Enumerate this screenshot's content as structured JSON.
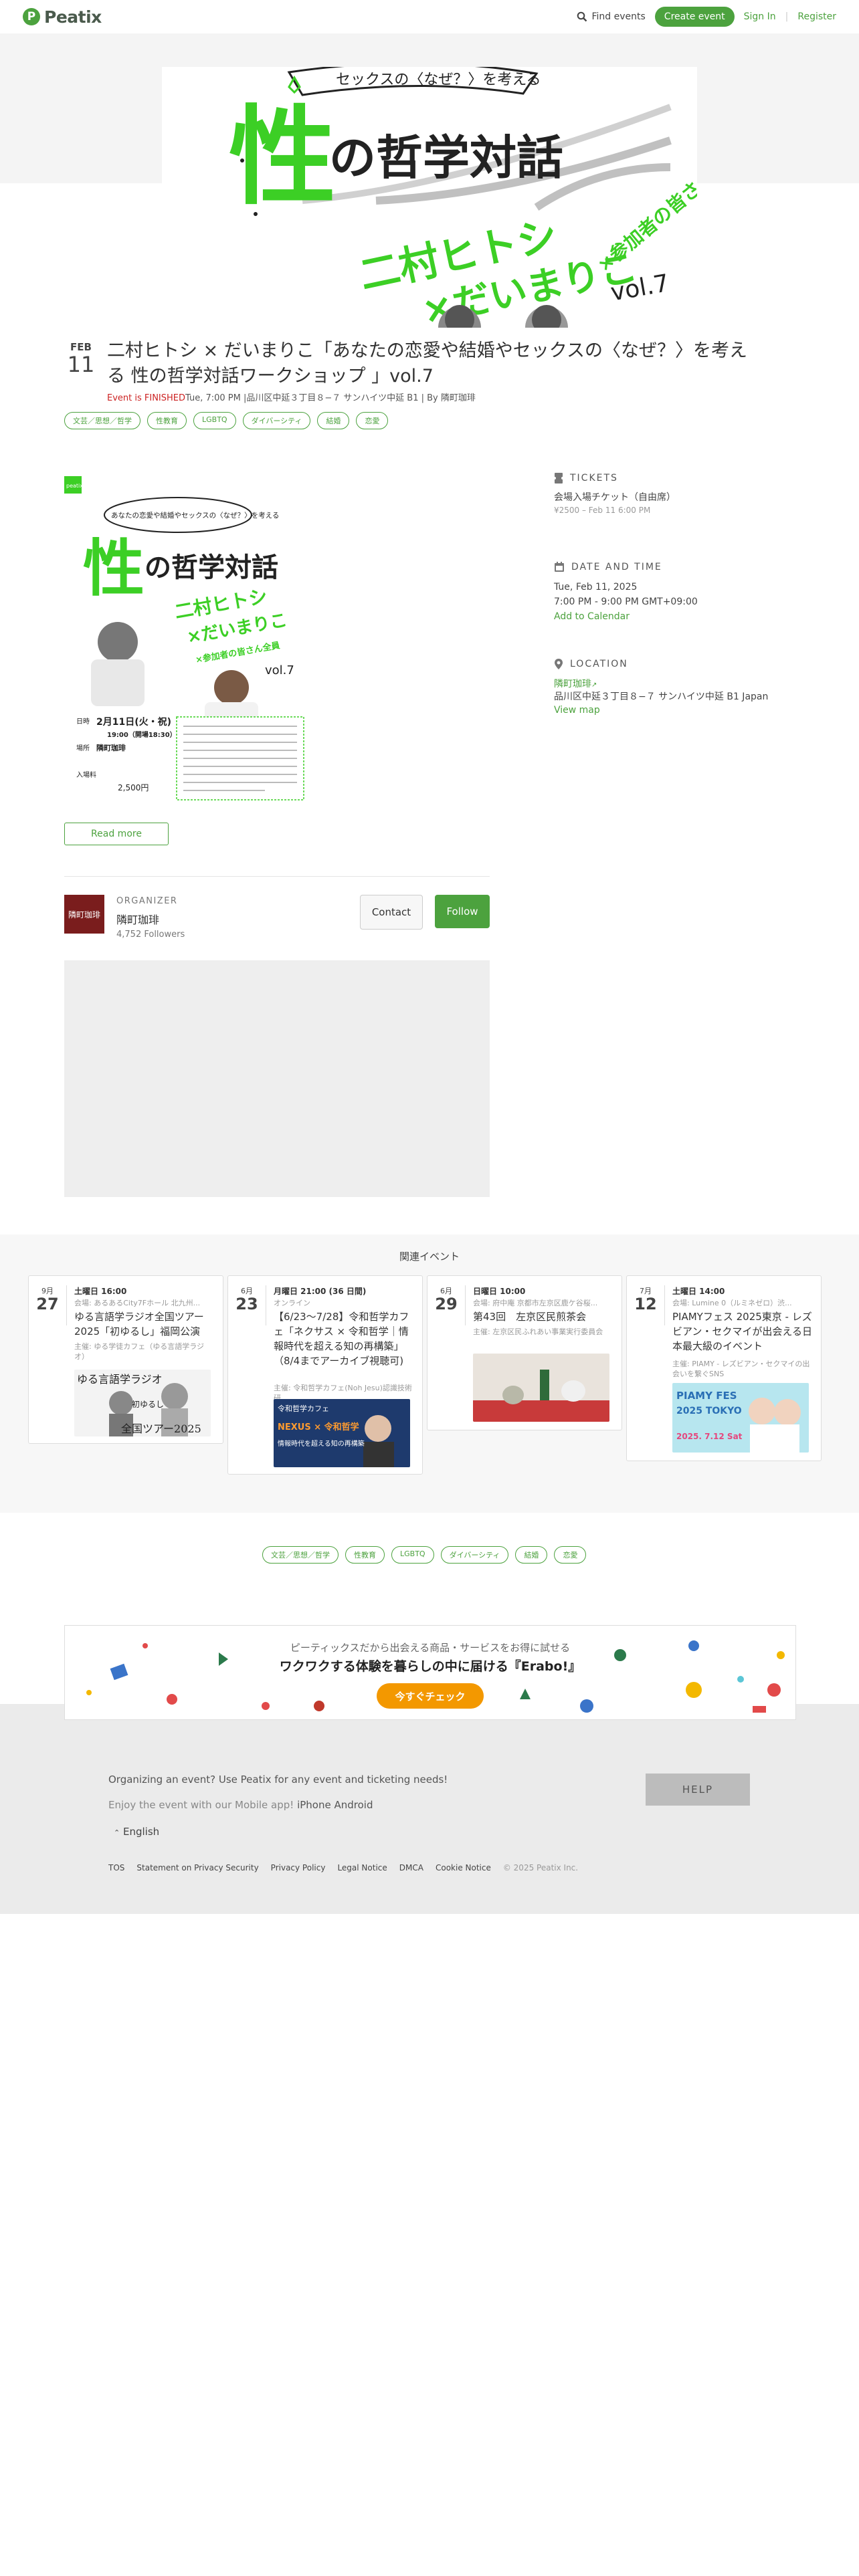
{
  "header": {
    "logo": "Peatix",
    "find": "Find events",
    "create": "Create event",
    "signin": "Sign In",
    "register": "Register"
  },
  "hero": {
    "top_text": "セックスの〈なぜ？〉を考える",
    "big1": "性",
    "big2": "の哲学対話",
    "names1": "二村ヒトシ",
    "names2": "×だいまりこ",
    "names3": "×参加者の皆さん全員",
    "vol": "vol.7"
  },
  "event": {
    "month": "FEB",
    "day": "11",
    "title": "二村ヒトシ × だいまりこ「あなたの恋愛や結婚やセックスの〈なぜ？〉を考える 性の哲学対話ワークショップ 」vol.7",
    "finished": "Event is FINISHED",
    "meta_rest": "Tue, 7:00 PM |品川区中延３丁目８−７ サンハイツ中延 B1 | By 隣町珈琲",
    "tags": [
      "文芸／思想／哲学",
      "性教育",
      "LGBTQ",
      "ダイバーシティ",
      "結婚",
      "恋愛"
    ]
  },
  "poster": {
    "badge": "peatix",
    "bubble": "あなたの恋愛や結婚やセックスの〈なぜ？〉を考える",
    "big1": "性",
    "big2": "の哲学対話",
    "names1": "二村ヒトシ",
    "names2": "×だいまりこ",
    "names3": "×参加者の皆さん全員",
    "vol": "vol.7",
    "date_label": "日時",
    "date_value": "2月11日(火・祝)",
    "time_value": "19:00（開場18:30）",
    "place_label": "場所",
    "place_value": "隣町珈琲",
    "fee_label": "入場料",
    "fee_value": "2,500円"
  },
  "read_more": "Read more",
  "organizer": {
    "label": "ORGANIZER",
    "logo_text": "隣町珈琲",
    "name": "隣町珈琲",
    "followers": "4,752 Followers",
    "contact": "Contact",
    "follow": "Follow"
  },
  "tickets": {
    "heading": "TICKETS",
    "name": "会場入場チケット（自由席）",
    "detail": "¥2500 – Feb 11 6:00 PM"
  },
  "datetime": {
    "heading": "DATE AND TIME",
    "date": "Tue, Feb 11, 2025",
    "time": "7:00 PM - 9:00 PM GMT+09:00",
    "calendar": "Add to Calendar"
  },
  "location": {
    "heading": "LOCATION",
    "venue": "隣町珈琲",
    "address": "品川区中延３丁目８−７ サンハイツ中延 B1 Japan",
    "map": "View map"
  },
  "related": {
    "title": "関連イベント",
    "cards": [
      {
        "month": "9月",
        "day": "27",
        "time": "土曜日 16:00",
        "venue": "会場: あるあるCity7Fホール 北九州...",
        "name": "ゆる言語学ラジオ全国ツアー2025「初ゆるし」福岡公演",
        "org": "主催: ゆる学徒カフェ（ゆる言語学ラジオ）",
        "img_text1": "ゆる言語学ラジオ",
        "img_text2": "初ゆるし",
        "img_text3": "全国ツアー2025"
      },
      {
        "month": "6月",
        "day": "23",
        "time": "月曜日 21:00 (36 日間)",
        "venue": "オンライン",
        "name": "【6/23〜7/28】令和哲学カフェ「ネクサス × 令和哲学｜情報時代を超える知の再構築」（8/4までアーカイブ視聴可)",
        "org": "主催: 令和哲学カフェ(Noh Jesu)認識技術研",
        "img_text1": "令和哲学カフェ",
        "img_text2": "NEXUS × 令和哲学",
        "img_text3": "情報時代を超える知の再構築"
      },
      {
        "month": "6月",
        "day": "29",
        "time": "日曜日 10:00",
        "venue": "会場: 府中庵 京都市左京区鹿ケ谷桜...",
        "name": "第43回　左京区民煎茶会",
        "org": "主催: 左京区民ふれあい事業実行委員会"
      },
      {
        "month": "7月",
        "day": "12",
        "time": "土曜日 14:00",
        "venue": "会場: Lumine 0（ルミネゼロ）渋...",
        "name": "PIAMYフェス 2025東京 - レズビアン・セクマイが出会える日本最大級のイベント",
        "org": "主催: PIAMY - レズビアン・セクマイの出会いを繋ぐSNS",
        "img_text1": "PIAMY FES",
        "img_text2": "2025 TOKYO",
        "img_text3": "2025. 7.12 Sat"
      }
    ],
    "tags": [
      "文芸／思想／哲学",
      "性教育",
      "LGBTQ",
      "ダイバーシティ",
      "結婚",
      "恋愛"
    ]
  },
  "banner": {
    "line1": "ピーティックスだから出会える商品・サービスをお得に試せる",
    "line2": "ワクワクする体験を暮らしの中に届ける『Erabo!』",
    "button": "今すぐチェック"
  },
  "footer": {
    "organizing": "Organizing an event? Use Peatix for any event and ticketing needs!",
    "enjoy": "Enjoy the event with our Mobile app!",
    "iphone": "iPhone",
    "android": "Android",
    "help": "HELP",
    "language": "English",
    "links": [
      "TOS",
      "Statement on Privacy Security",
      "Privacy Policy",
      "Legal Notice",
      "DMCA",
      "Cookie Notice"
    ],
    "copyright": "© 2025 Peatix Inc."
  },
  "colors": {
    "brand": "#4ca23e",
    "hero_green": "#3ccf25",
    "finished": "#cc2222",
    "banner_button": "#f39800"
  }
}
